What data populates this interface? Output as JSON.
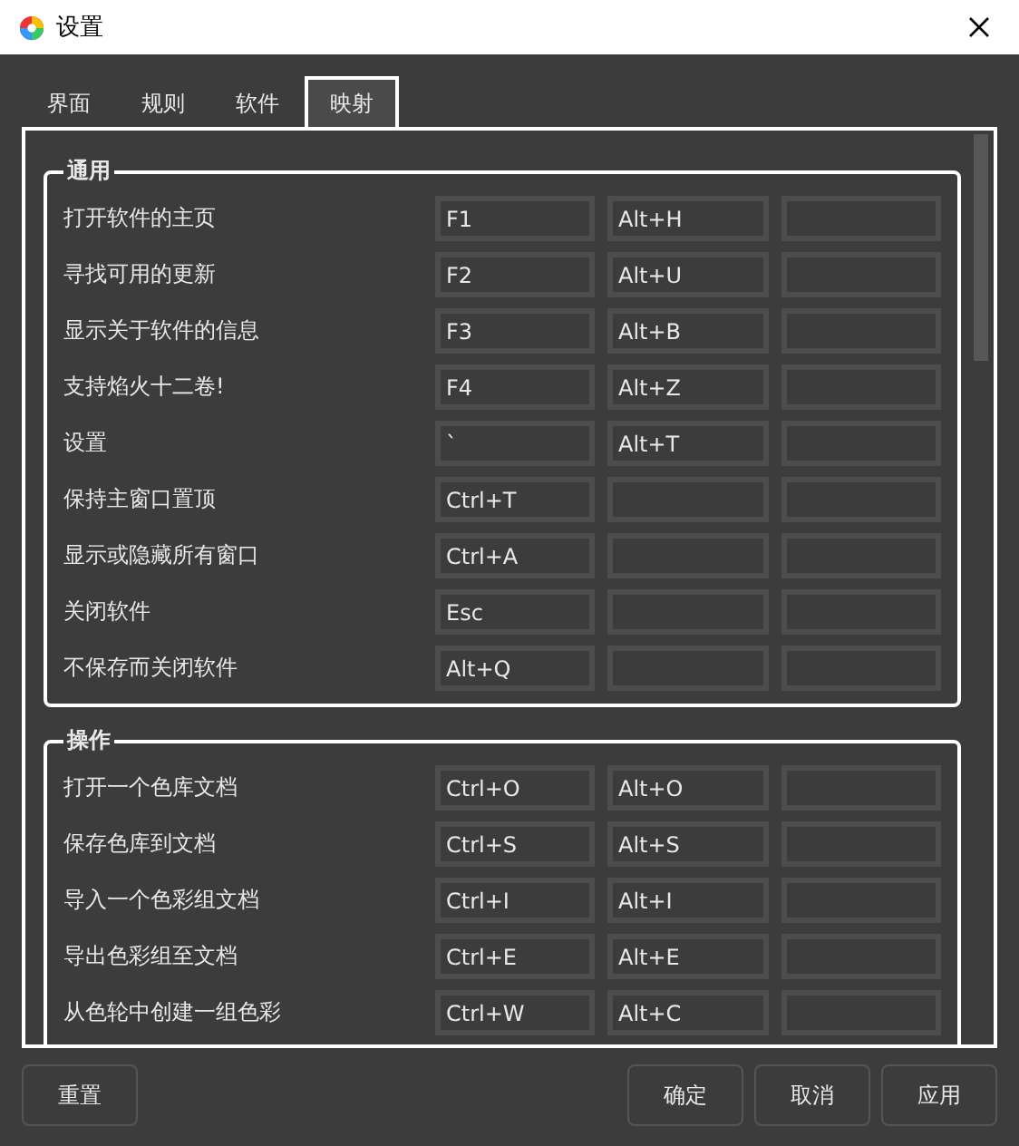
{
  "window": {
    "title": "设置"
  },
  "tabs": [
    {
      "label": "界面",
      "selected": false
    },
    {
      "label": "规则",
      "selected": false
    },
    {
      "label": "软件",
      "selected": false
    },
    {
      "label": "映射",
      "selected": true
    }
  ],
  "groups": [
    {
      "title": "通用",
      "rows": [
        {
          "label": "打开软件的主页",
          "keys": [
            "F1",
            "Alt+H"
          ]
        },
        {
          "label": "寻找可用的更新",
          "keys": [
            "F2",
            "Alt+U"
          ]
        },
        {
          "label": "显示关于软件的信息",
          "keys": [
            "F3",
            "Alt+B"
          ]
        },
        {
          "label": "支持焰火十二卷!",
          "keys": [
            "F4",
            "Alt+Z"
          ]
        },
        {
          "label": "设置",
          "keys": [
            "`",
            "Alt+T"
          ]
        },
        {
          "label": "保持主窗口置顶",
          "keys": [
            "Ctrl+T"
          ]
        },
        {
          "label": "显示或隐藏所有窗口",
          "keys": [
            "Ctrl+A"
          ]
        },
        {
          "label": "关闭软件",
          "keys": [
            "Esc"
          ]
        },
        {
          "label": "不保存而关闭软件",
          "keys": [
            "Alt+Q"
          ]
        }
      ]
    },
    {
      "title": "操作",
      "rows": [
        {
          "label": "打开一个色库文档",
          "keys": [
            "Ctrl+O",
            "Alt+O"
          ]
        },
        {
          "label": "保存色库到文档",
          "keys": [
            "Ctrl+S",
            "Alt+S"
          ]
        },
        {
          "label": "导入一个色彩组文档",
          "keys": [
            "Ctrl+I",
            "Alt+I"
          ]
        },
        {
          "label": "导出色彩组至文档",
          "keys": [
            "Ctrl+E",
            "Alt+E"
          ]
        },
        {
          "label": "从色轮中创建一组色彩",
          "keys": [
            "Ctrl+W",
            "Alt+C"
          ]
        }
      ]
    }
  ],
  "buttons_left": [
    "重置"
  ],
  "buttons_right": [
    "确定",
    "取消",
    "应用"
  ]
}
